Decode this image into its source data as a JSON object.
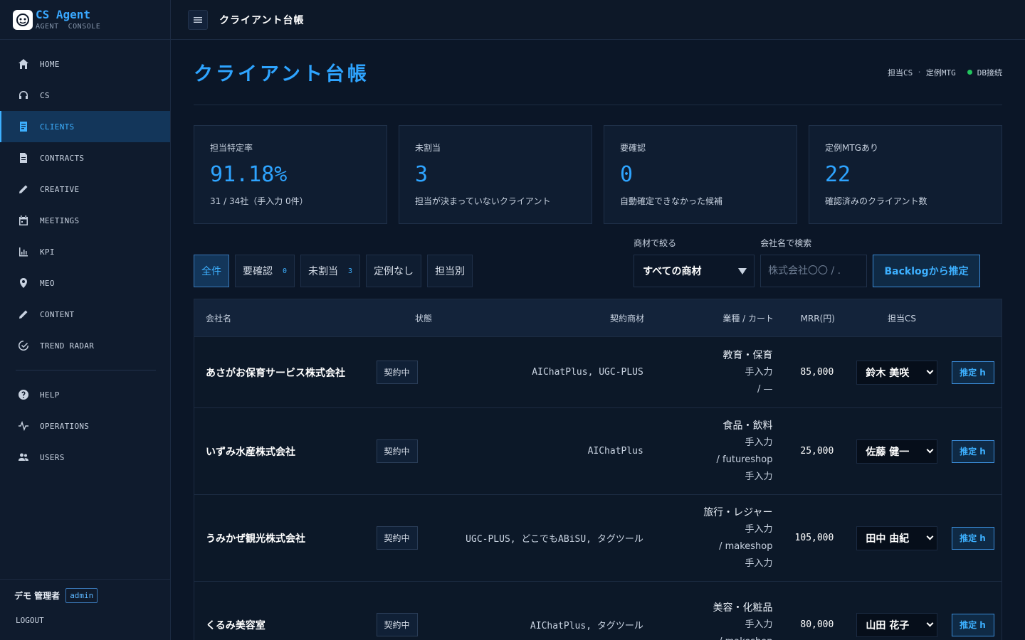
{
  "brand": {
    "title": "CS Agent",
    "subtitle": "AGENT  CONSOLE"
  },
  "sidebar": {
    "items": [
      {
        "label": "HOME",
        "icon": "home-icon"
      },
      {
        "label": "CS",
        "icon": "headset-icon"
      },
      {
        "label": "CLIENTS",
        "icon": "clients-icon",
        "active": true
      },
      {
        "label": "CONTRACTS",
        "icon": "document-icon"
      },
      {
        "label": "CREATIVE",
        "icon": "pencil-icon"
      },
      {
        "label": "MEETINGS",
        "icon": "calendar-icon"
      },
      {
        "label": "KPI",
        "icon": "bar-chart-icon"
      },
      {
        "label": "MEO",
        "icon": "map-pin-icon"
      },
      {
        "label": "CONTENT",
        "icon": "pencil-icon"
      },
      {
        "label": "TREND RADAR",
        "icon": "radar-icon"
      }
    ],
    "secondary": [
      {
        "label": "HELP",
        "icon": "help-icon"
      },
      {
        "label": "OPERATIONS",
        "icon": "pulse-icon"
      },
      {
        "label": "USERS",
        "icon": "users-icon"
      }
    ],
    "user": {
      "name": "デモ 管理者",
      "role": "admin"
    },
    "logout": "LOGOUT"
  },
  "topbar": {
    "title": "クライアント台帳"
  },
  "page": {
    "title": "クライアント台帳",
    "meta": {
      "a": "担当CS",
      "sep": "·",
      "b": "定例MTG",
      "status": "DB接続"
    }
  },
  "stats": [
    {
      "label": "担当特定率",
      "value": "91.18%",
      "note": "31 / 34社（手入力 0件）"
    },
    {
      "label": "未割当",
      "value": "3",
      "note": "担当が決まっていないクライアント"
    },
    {
      "label": "要確認",
      "value": "0",
      "note": "自動確定できなかった候補"
    },
    {
      "label": "定例MTGあり",
      "value": "22",
      "note": "確認済みのクライアント数"
    }
  ],
  "filters": {
    "tabs": [
      {
        "label": "全件",
        "count": ""
      },
      {
        "label": "要確認",
        "count": "0"
      },
      {
        "label": "未割当",
        "count": "3"
      },
      {
        "label": "定例なし",
        "count": ""
      },
      {
        "label": "担当別",
        "count": ""
      }
    ],
    "product_label": "商材で絞る",
    "product_value": "すべての商材",
    "search_label": "会社名で検索",
    "search_placeholder": "株式会社〇〇 / .",
    "suggest_button": "Backlogから推定"
  },
  "table": {
    "headers": {
      "name": "会社名",
      "status": "状態",
      "product": "契約商材",
      "industry": "業種 / カート",
      "mrr": "MRR(円)",
      "cs": "担当CS"
    },
    "rows": [
      {
        "name": "あさがお保育サービス株式会社",
        "status": "契約中",
        "product": "AIChatPlus, UGC-PLUS",
        "industry": "教育・保育",
        "ind2": "手入力",
        "ind3": "/ —",
        "ind4": "",
        "mrr": "85,000",
        "cs": "鈴木 美咲",
        "action": "推定 h"
      },
      {
        "name": "いずみ水産株式会社",
        "status": "契約中",
        "product": "AIChatPlus",
        "industry": "食品・飲料",
        "ind2": "手入力",
        "ind3": "/ futureshop",
        "ind4": "手入力",
        "mrr": "25,000",
        "cs": "佐藤 健一",
        "action": "推定 h"
      },
      {
        "name": "うみかぜ観光株式会社",
        "status": "契約中",
        "product": "UGC-PLUS, どこでもABiSU, タグツール",
        "industry": "旅行・レジャー",
        "ind2": "手入力",
        "ind3": "/ makeshop",
        "ind4": "手入力",
        "mrr": "105,000",
        "cs": "田中 由紀",
        "action": "推定 h"
      },
      {
        "name": "くるみ美容室",
        "status": "契約中",
        "product": "AIChatPlus, タグツール",
        "industry": "美容・化粧品",
        "ind2": "手入力",
        "ind3": "/ makeshop",
        "ind4": "",
        "mrr": "80,000",
        "cs": "山田 花子",
        "action": "推定 h"
      }
    ]
  },
  "colors": {
    "accent": "#2ea4ff",
    "bg": "#0b1627",
    "sidebar": "#0f1b2d",
    "status_ok": "#22c55e"
  }
}
